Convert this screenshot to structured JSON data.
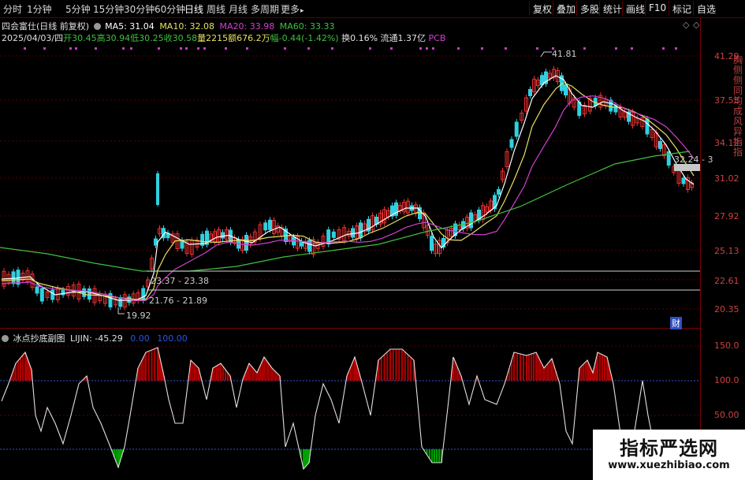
{
  "toolbar": {
    "periods": [
      "分时",
      "1分钟",
      "5分钟",
      "15分钟",
      "30分钟",
      "60分钟",
      "日线",
      "周线",
      "月线",
      "多周期",
      "更多"
    ],
    "more_arrow": "▸",
    "buttons": [
      "复权",
      "叠加",
      "多股",
      "统计",
      "画线",
      "F10",
      "标记",
      "自选"
    ],
    "active_period": "日线"
  },
  "header": {
    "title": "四会富仕(日线 前复权)",
    "ma5": "MA5: 31.04",
    "ma10": "MA10: 32.08",
    "ma20": "MA20: 33.98",
    "ma60": "MA60: 33.33",
    "date": "2025/04/03/四",
    "open": "开30.45",
    "high": "高30.94",
    "low": "低30.25",
    "close": "收30.58",
    "volume": "量2215",
    "amount": "额676.2万",
    "change": "幅-0.44(-1.42%)",
    "turnover": "换0.16%",
    "float": "流通1.37亿",
    "pcb": "PCB",
    "ctrl1": "◇",
    "ctrl2": "◇"
  },
  "price_axis": [
    "41.29",
    "37.53",
    "34.12",
    "31.02",
    "27.92",
    "25.13",
    "22.61",
    "20.35"
  ],
  "annotations": {
    "high_mark": "41.81",
    "low_mark": "19.92",
    "range1": "23.37 - 23.38",
    "range2": "21.76 - 21.89",
    "range3": "32.24 - 3",
    "cai": "财"
  },
  "indicator": {
    "name": "冰点抄底副图",
    "lijin": "LIJIN: -45.29",
    "v1": "0.00",
    "v2": "100.00",
    "axis": [
      "150.0",
      "100.0",
      "50.00"
    ]
  },
  "colors": {
    "up": "#e83030",
    "down": "#30d0e0",
    "ma5": "#ffffff",
    "ma10": "#e8e060",
    "ma20": "#d040d0",
    "ma60": "#40c040",
    "fill_red": "#b00000",
    "fill_green": "#00a000"
  },
  "watermark": {
    "title": "指标严选网",
    "url": "www.xuezhibiao.com"
  },
  "side_glyphs": "胸侧侧同均成风异 指 指"
}
